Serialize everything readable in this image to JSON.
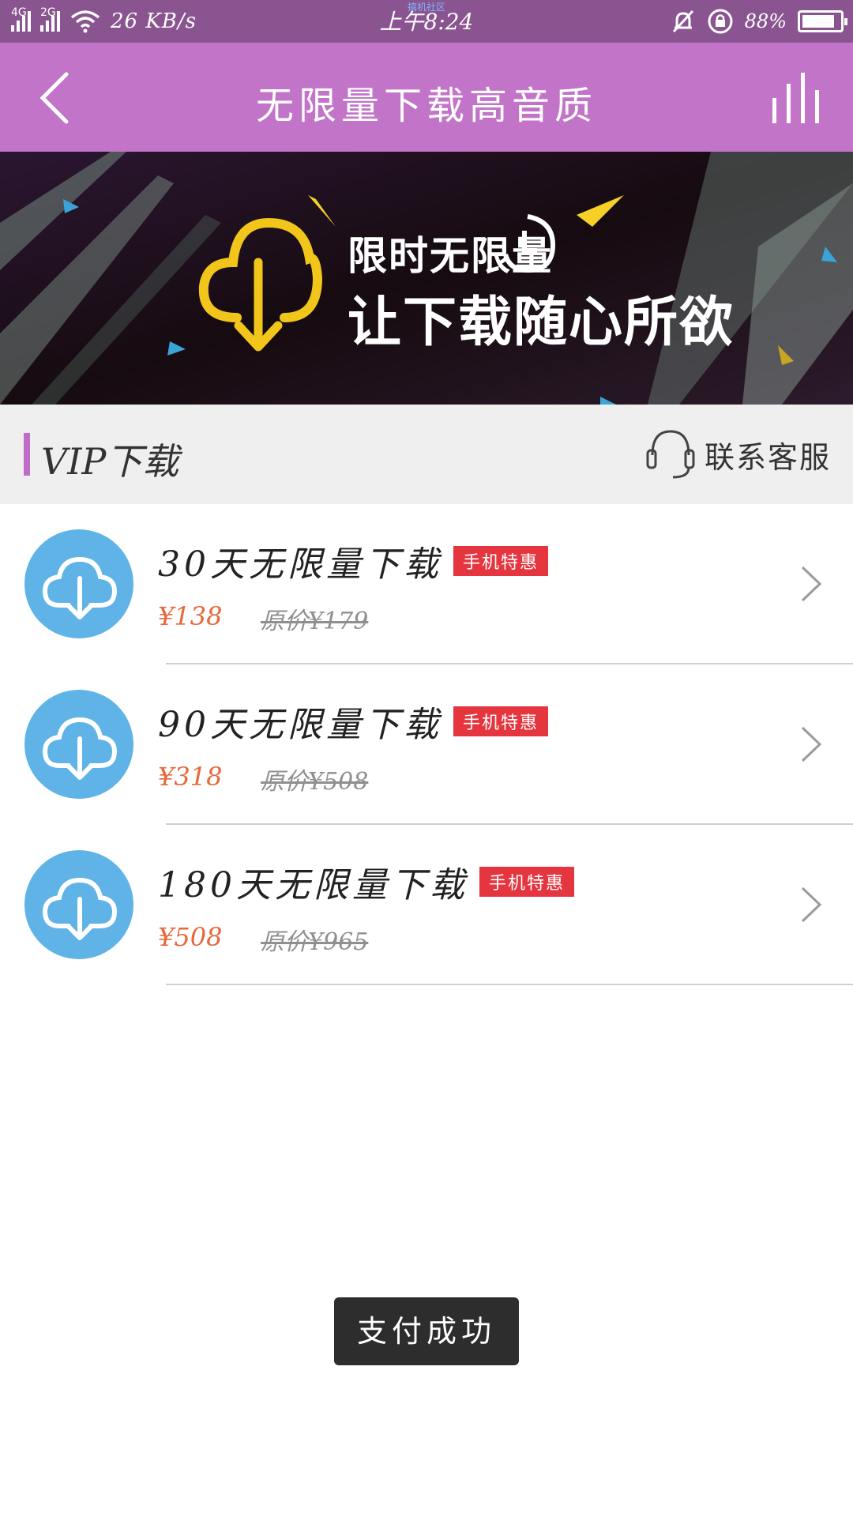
{
  "status_bar": {
    "network1": "4G",
    "network2": "2G",
    "speed": "26 KB/s",
    "time": "上午8:24",
    "notice": "搞机社区",
    "battery": "88%",
    "battery_level": 0.88
  },
  "header": {
    "title": "无限量下载高音质",
    "back_icon": "chevron-left-icon",
    "menu_icon": "equalizer-icon"
  },
  "banner": {
    "line1": "限时无限量",
    "line2": "让下载随心所欲"
  },
  "section": {
    "title": "VIP下载",
    "service_label": "联系客服",
    "service_icon": "headset-icon"
  },
  "packages": [
    {
      "title": "30天无限量下载",
      "badge": "手机特惠",
      "price": "¥138",
      "original_price": "原价¥179"
    },
    {
      "title": "90天无限量下载",
      "badge": "手机特惠",
      "price": "¥318",
      "original_price": "原价¥508"
    },
    {
      "title": "180天无限量下载",
      "badge": "手机特惠",
      "price": "¥508",
      "original_price": "原价¥965"
    }
  ],
  "toast": {
    "text": "支付成功"
  },
  "colors": {
    "status_bar": "#8a5491",
    "header": "#c274c8",
    "accent_marker": "#c06cc9",
    "icon_blue": "#5fb3e6",
    "badge_red": "#e5353f",
    "price_orange": "#e7683a"
  }
}
